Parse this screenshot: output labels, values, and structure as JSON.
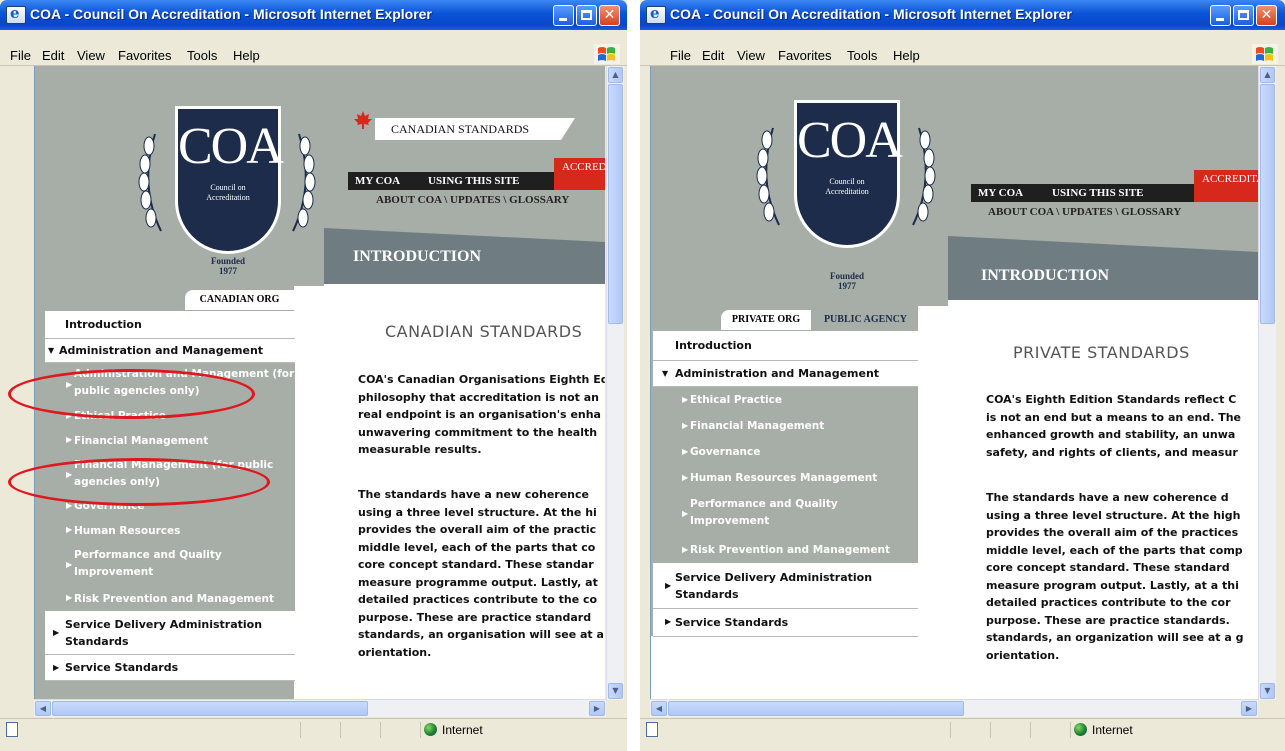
{
  "windows": [
    {
      "title": "COA - Council On Accreditation - Microsoft Internet Explorer",
      "menu": [
        "File",
        "Edit",
        "View",
        "Favorites",
        "Tools",
        "Help"
      ],
      "logo": {
        "initials": "COA",
        "line1": "Council on",
        "line2": "Accreditation",
        "founded": "Founded",
        "year": "1977"
      },
      "canadian_banner": "CANADIAN STANDARDS",
      "nav_primary": [
        "MY COA",
        "USING THIS SITE"
      ],
      "nav_red": "ACCREDITATION",
      "nav_sub": "ABOUT COA \\ UPDATES \\ GLOSSARY",
      "section_header": "INTRODUCTION",
      "org_tab": "CANADIAN ORG",
      "nav": {
        "introduction": "Introduction",
        "admin": "Administration and Management",
        "sub_items": [
          "Administration and Management (for",
          "public agencies only)",
          "Ethical Practice",
          "Financial Management",
          "Financial Management (for public",
          "agencies only)",
          "Governance",
          "Human Resources",
          "Performance and Quality",
          "Improvement",
          "Risk Prevention and Management"
        ],
        "service_delivery": [
          "Service Delivery Administration",
          "Standards"
        ],
        "service": "Service Standards"
      },
      "heading": "CANADIAN STANDARDS",
      "para1": [
        "COA's Canadian Organisations Eighth Ed",
        "philosophy that accreditation is not an",
        "real endpoint is an organisation's enha",
        "unwavering commitment to the health",
        "measurable results."
      ],
      "para2": [
        "The standards have a new coherence",
        "using a three level structure. At the hi",
        "provides the overall aim of the practic",
        "middle level, each of the parts that co",
        "core concept standard. These standar",
        "measure programme output. Lastly, at",
        "detailed practices contribute to the co",
        "purpose. These are practice standard",
        "standards, an organisation will see at a",
        "orientation."
      ],
      "status": "Internet"
    },
    {
      "title": "COA - Council On Accreditation - Microsoft Internet Explorer",
      "menu": [
        "File",
        "Edit",
        "View",
        "Favorites",
        "Tools",
        "Help"
      ],
      "logo": {
        "initials": "COA",
        "line1": "Council on",
        "line2": "Accreditation",
        "founded": "Founded",
        "year": "1977"
      },
      "nav_primary": [
        "MY COA",
        "USING THIS SITE"
      ],
      "nav_red": "ACCREDITATION",
      "nav_sub": "ABOUT COA \\ UPDATES \\ GLOSSARY",
      "section_header": "INTRODUCTION",
      "org_tabs": [
        "PRIVATE ORG",
        "PUBLIC AGENCY"
      ],
      "nav": {
        "introduction": "Introduction",
        "admin": "Administration and Management",
        "sub_items": [
          "Ethical Practice",
          "Financial Management",
          "Governance",
          "Human Resources Management",
          "Performance and Quality",
          "Improvement",
          "Risk Prevention and Management"
        ],
        "service_delivery": [
          "Service Delivery Administration",
          "Standards"
        ],
        "service": "Service Standards"
      },
      "heading": "PRIVATE STANDARDS",
      "para1": [
        "COA's Eighth Edition Standards reflect C",
        "is not an end but a means to an end. The",
        "enhanced growth and stability, an unwa",
        "safety, and rights of clients, and measur"
      ],
      "para2": [
        "The standards have a new coherence d",
        "using a three level structure. At the high",
        "provides the overall aim of the practices",
        "middle level, each of the parts that comp",
        "core concept standard. These standard",
        "measure program output. Lastly, at a thi",
        "detailed practices contribute to the cor",
        "purpose. These are practice standards.",
        "standards, an organization will see at a g",
        "orientation."
      ],
      "status": "Internet"
    }
  ],
  "colors": {
    "annotation": "#e0171c",
    "accent_red": "#d6291b",
    "shield": "#1c2c4a",
    "sidebar_gray": "#a7aea8",
    "band_gray": "#6f7d83"
  }
}
